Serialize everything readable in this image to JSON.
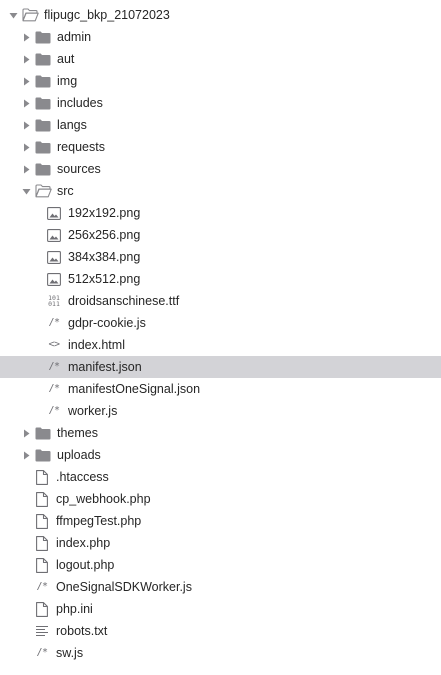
{
  "root": {
    "label": "flipugc_bkp_21072023",
    "expanded": true
  },
  "folders_top": [
    {
      "label": "admin"
    },
    {
      "label": "aut"
    },
    {
      "label": "img"
    },
    {
      "label": "includes"
    },
    {
      "label": "langs"
    },
    {
      "label": "requests"
    },
    {
      "label": "sources"
    }
  ],
  "src": {
    "label": "src",
    "expanded": true,
    "files": [
      {
        "label": "192x192.png",
        "icon": "image-icon"
      },
      {
        "label": "256x256.png",
        "icon": "image-icon"
      },
      {
        "label": "384x384.png",
        "icon": "image-icon"
      },
      {
        "label": "512x512.png",
        "icon": "image-icon"
      },
      {
        "label": "droidsanschinese.ttf",
        "icon": "binary-icon"
      },
      {
        "label": "gdpr-cookie.js",
        "icon": "code-comment-icon"
      },
      {
        "label": "index.html",
        "icon": "angle-brackets-icon"
      },
      {
        "label": "manifest.json",
        "icon": "code-comment-icon",
        "selected": true
      },
      {
        "label": "manifestOneSignal.json",
        "icon": "code-comment-icon"
      },
      {
        "label": "worker.js",
        "icon": "code-comment-icon"
      }
    ]
  },
  "folders_bottom": [
    {
      "label": "themes"
    },
    {
      "label": "uploads"
    }
  ],
  "root_files": [
    {
      "label": ".htaccess",
      "icon": "document-icon"
    },
    {
      "label": "cp_webhook.php",
      "icon": "document-icon"
    },
    {
      "label": "ffmpegTest.php",
      "icon": "document-icon"
    },
    {
      "label": "index.php",
      "icon": "document-icon"
    },
    {
      "label": "logout.php",
      "icon": "document-icon"
    },
    {
      "label": "OneSignalSDKWorker.js",
      "icon": "code-comment-icon"
    },
    {
      "label": "php.ini",
      "icon": "document-icon"
    },
    {
      "label": "robots.txt",
      "icon": "text-lines-icon"
    },
    {
      "label": "sw.js",
      "icon": "code-comment-icon"
    }
  ],
  "glyphs": {
    "code_comment": "/*",
    "angle_brackets": "<>",
    "binary_top": "101",
    "binary_bottom": "011"
  },
  "colors": {
    "folder": "#8a8a8e",
    "icon": "#6f6f74",
    "selected_row": "#d3d3d7",
    "text": "#262626"
  }
}
